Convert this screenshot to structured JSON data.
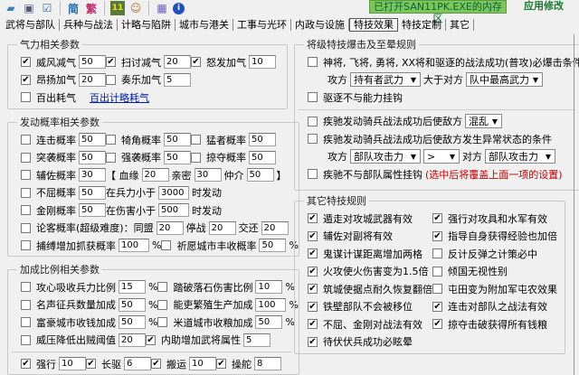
{
  "toolbar": {
    "icons": [
      "folder-open-icon",
      "save-icon",
      "checklist-icon",
      "simplified-icon",
      "traditional-icon",
      "san11-icon",
      "face-icon",
      "grid-icon",
      "info-icon"
    ],
    "simplified": "简",
    "traditional": "繁",
    "san11": "11"
  },
  "status": "已打开SAN11PK.EXE的内存区",
  "apply": "应用修改",
  "tabs": [
    "武将与部队",
    "兵种与战法",
    "计略与陷阱",
    "城市与港关",
    "工事与光环",
    "内政与设施",
    "特技效果",
    "特技定制",
    "其它"
  ],
  "active_tab": "特技效果",
  "groups": [
    {
      "id": "g1",
      "title": "气力相关参数",
      "rows": [
        [
          {
            "c": true,
            "p": [
              "威风减气",
              {
                "v": "50"
              }
            ]
          },
          {
            "c": true,
            "p": [
              "扫讨减气",
              {
                "v": "20"
              }
            ]
          },
          {
            "c": true,
            "p": [
              "怒发加气",
              {
                "v": "10"
              }
            ]
          }
        ],
        [
          {
            "c": true,
            "p": [
              "昂扬加气",
              {
                "v": "20"
              }
            ]
          },
          {
            "c": false,
            "p": [
              "奏乐加气",
              {
                "v": "5"
              }
            ]
          }
        ],
        [
          {
            "c": false,
            "p": [
              "百出耗气",
              {
                "link": "百出计略耗气"
              }
            ]
          }
        ]
      ]
    },
    {
      "id": "g2",
      "title": "发动概率相关参数",
      "rows": [
        [
          {
            "c": false,
            "p": [
              "连击概率",
              {
                "v": "50"
              }
            ]
          },
          {
            "c": false,
            "p": [
              "犄角概率",
              {
                "v": "50"
              }
            ]
          },
          {
            "c": false,
            "p": [
              "猛者概率",
              {
                "v": "50"
              }
            ]
          }
        ],
        [
          {
            "c": false,
            "p": [
              "突袭概率",
              {
                "v": "50"
              }
            ]
          },
          {
            "c": false,
            "p": [
              "强袭概率",
              {
                "v": "50"
              }
            ]
          },
          {
            "c": false,
            "p": [
              "掠夺概率",
              {
                "v": "50"
              }
            ]
          }
        ],
        [
          {
            "c": false,
            "p": [
              "辅佐概率",
              {
                "v": "30"
              }
            ]
          },
          {
            "c": null,
            "p": [
              "【 血缘",
              {
                "v": "20"
              },
              "亲密",
              {
                "v": "30"
              },
              "仲介",
              {
                "v": "50"
              },
              "】"
            ]
          }
        ],
        [
          {
            "c": false,
            "p": [
              "不屈概率",
              {
                "v": "50"
              }
            ]
          },
          {
            "c": null,
            "p": [
              "在兵力小于",
              {
                "v": "3000"
              },
              "时发动"
            ]
          }
        ],
        [
          {
            "c": false,
            "p": [
              "金刚概率",
              {
                "v": "50"
              }
            ]
          },
          {
            "c": null,
            "p": [
              "在伤害小于",
              {
                "v": "500"
              },
              "时发动"
            ]
          }
        ],
        [
          {
            "c": false,
            "p": [
              "论客概率(超级难度)：同盟",
              {
                "v": "20"
              },
              "停战",
              {
                "v": "20"
              },
              "交还",
              {
                "v": "20"
              }
            ]
          }
        ],
        [
          {
            "c": false,
            "p": [
              "捕缚增加抓获概率",
              {
                "v": "100"
              },
              "%"
            ]
          },
          {
            "c": false,
            "p": [
              "祈愿城市丰收概率",
              {
                "v": "50"
              },
              "%"
            ]
          }
        ]
      ]
    },
    {
      "id": "g3",
      "title": "加成比例相关参数",
      "rows": [
        [
          {
            "c": false,
            "p": [
              "攻心吸收兵力比例",
              {
                "v": "15"
              },
              "%"
            ]
          },
          {
            "c": false,
            "p": [
              "踏破落石伤害比例",
              {
                "v": "10"
              },
              "%"
            ]
          }
        ],
        [
          {
            "c": false,
            "p": [
              "名声征兵数量加成",
              {
                "v": "50"
              },
              "%"
            ]
          },
          {
            "c": false,
            "p": [
              "能吏繁殖生产加成",
              {
                "v": "100"
              },
              "%"
            ]
          }
        ],
        [
          {
            "c": false,
            "p": [
              "富豪城市收钱加成",
              {
                "v": "50"
              },
              "%"
            ]
          },
          {
            "c": false,
            "p": [
              "米道城市收粮加成",
              {
                "v": "50"
              },
              "%"
            ]
          }
        ],
        [
          {
            "c": false,
            "p": [
              "威压降低出贼阈值",
              {
                "v": "20"
              }
            ]
          },
          {
            "c": true,
            "p": [
              "内助增加武将属性",
              {
                "v": "5"
              }
            ]
          }
        ],
        "hr",
        [
          {
            "c": true,
            "p": [
              "强行",
              {
                "v": "10"
              }
            ]
          },
          {
            "c": true,
            "p": [
              "长驱",
              {
                "v": "6"
              }
            ]
          },
          {
            "c": true,
            "p": [
              "搬运",
              {
                "v": "10"
              }
            ]
          },
          {
            "c": true,
            "p": [
              "操舵",
              {
                "v": "8"
              }
            ]
          }
        ]
      ]
    },
    {
      "id": "g4",
      "title": "将级特技爆击及至晕规则",
      "rows": [
        [
          {
            "c": false,
            "p": [
              "神将, 飞将, 勇将, XX将和驱逐的战法成功(普攻)必爆击条件"
            ]
          }
        ],
        [
          {
            "c": null,
            "p": [
              "攻方",
              {
                "sel": "持有者武力"
              },
              "大于对方",
              {
                "sel": "队中最高武力"
              }
            ]
          }
        ],
        [
          {
            "c": false,
            "p": [
              "驱逐不与能力挂钩"
            ]
          }
        ],
        "hr",
        [
          {
            "c": false,
            "p": [
              "疾驰发动骑兵战法成功后使敌方",
              {
                "sel": "混乱"
              }
            ]
          }
        ],
        [
          {
            "c": false,
            "p": [
              "疾驰发动骑兵战法成功后使敌方发生异常状态的条件"
            ]
          }
        ],
        [
          {
            "c": null,
            "p": [
              "攻方",
              {
                "sel": "部队攻击力"
              },
              {
                "sel": ">"
              },
              "对方",
              {
                "sel": "部队攻击力"
              }
            ]
          }
        ],
        [
          {
            "c": false,
            "p": [
              "疾驰不与部队属性挂钩",
              {
                "red": "(选中后将覆盖上面一项的设置)"
              }
            ]
          }
        ]
      ]
    },
    {
      "id": "g5",
      "title": "其它特技规则",
      "rows": [
        [
          {
            "c": true,
            "p": [
              "遁走对攻城武器有效"
            ]
          },
          {
            "c": true,
            "p": [
              "强行对攻具和水军有效"
            ]
          }
        ],
        [
          {
            "c": true,
            "p": [
              "辅佐对副将有效"
            ]
          },
          {
            "c": true,
            "p": [
              "指导自身获得经验也加倍"
            ]
          }
        ],
        [
          {
            "c": true,
            "p": [
              "鬼谋计谋距离增加两格"
            ]
          },
          {
            "c": false,
            "p": [
              "反计反弹之计策必中"
            ]
          }
        ],
        [
          {
            "c": true,
            "p": [
              "火攻使火伤害变为1.5倍"
            ]
          },
          {
            "c": false,
            "p": [
              "倾国无视性别"
            ]
          }
        ],
        [
          {
            "c": true,
            "p": [
              "筑城使据点耐久恢复翻倍"
            ]
          },
          {
            "c": false,
            "p": [
              "屯田变为附加军屯农效果"
            ]
          }
        ],
        [
          {
            "c": true,
            "p": [
              "铁壁部队不会被移位"
            ]
          },
          {
            "c": true,
            "p": [
              "连击对部队之战法有效"
            ]
          }
        ],
        [
          {
            "c": true,
            "p": [
              "不屈、金刚对战法有效"
            ]
          },
          {
            "c": true,
            "p": [
              "掠夺击破获得所有钱粮"
            ]
          }
        ],
        [
          {
            "c": true,
            "p": [
              "待伏伏兵成功必眩晕"
            ]
          }
        ]
      ]
    }
  ]
}
